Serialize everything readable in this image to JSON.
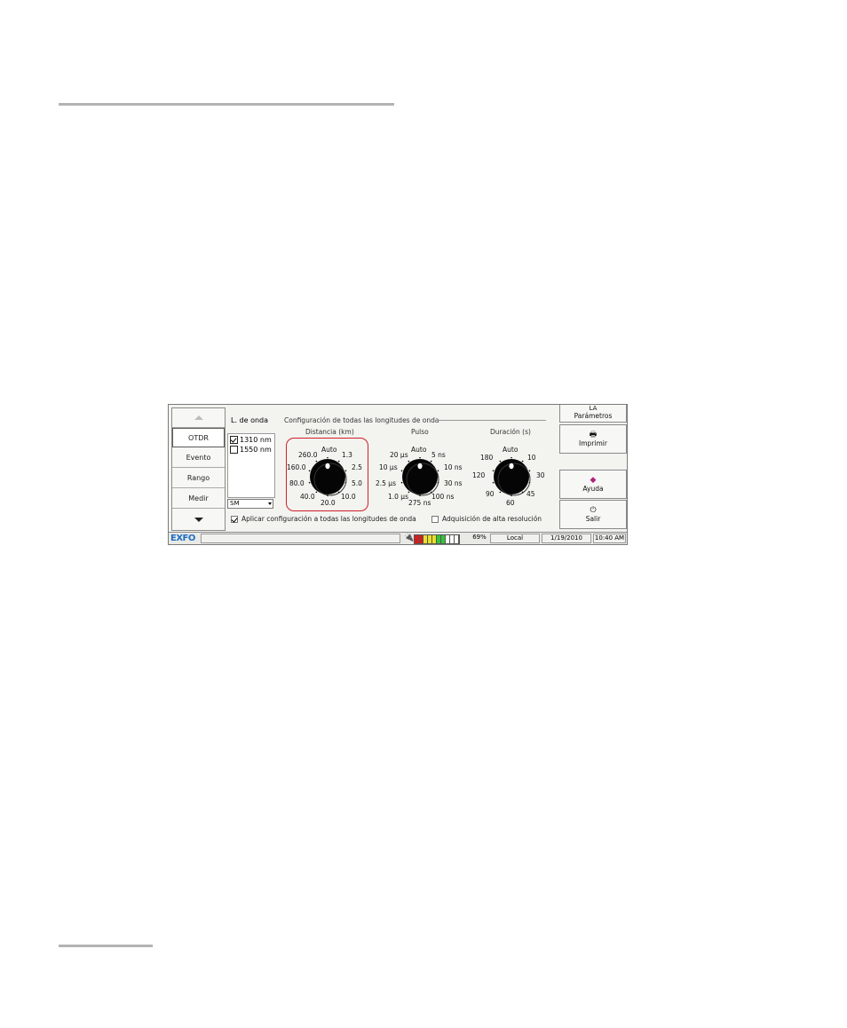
{
  "nav": {
    "items": [
      "OTDR",
      "Evento",
      "Rango",
      "Medir"
    ]
  },
  "wavelengths": {
    "title": "L. de onda",
    "items": [
      {
        "label": "1310 nm",
        "checked": true
      },
      {
        "label": "1550 nm",
        "checked": false
      }
    ],
    "fiber_type": "SM"
  },
  "config": {
    "title": "Configuración de todas las longitudes de onda",
    "distance": {
      "title": "Distancia (km)",
      "labels": [
        "Auto",
        "1.3",
        "2.5",
        "5.0",
        "10.0",
        "20.0",
        "40.0",
        "80.0",
        "160.0",
        "260.0"
      ]
    },
    "pulse": {
      "title": "Pulso",
      "labels": [
        "Auto",
        "5 ns",
        "10 ns",
        "30 ns",
        "100 ns",
        "275 ns",
        "1.0 µs",
        "2.5 µs",
        "10 µs",
        "20 µs"
      ]
    },
    "duration": {
      "title": "Duración (s)",
      "labels": [
        "Auto",
        "10",
        "30",
        "45",
        "60",
        "90",
        "120",
        "180"
      ]
    },
    "apply_all": {
      "label": "Aplicar configuración a todas las longitudes de onda",
      "checked": true
    },
    "high_res": {
      "label": "Adquisición de alta resolución",
      "checked": false
    }
  },
  "right_buttons": {
    "params_top": "LA",
    "params": "Parámetros",
    "print": "Imprimir",
    "help": "Ayuda",
    "exit": "Salir"
  },
  "status": {
    "logo": "EXFO",
    "battery_percent_text": "69%",
    "battery_fill": 0.69,
    "mode": "Local",
    "date": "1/19/2010",
    "time": "10:40 AM"
  },
  "colors": {
    "highlight": "#d0202a",
    "logo": "#1f6fc0"
  }
}
